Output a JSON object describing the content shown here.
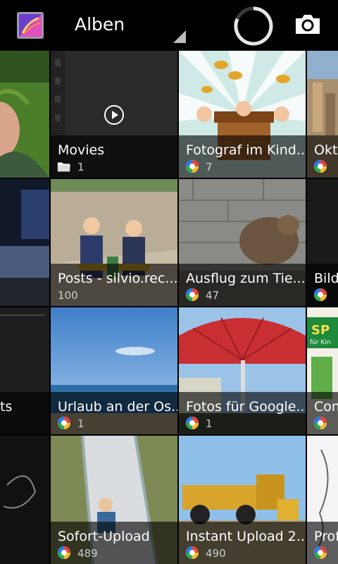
{
  "actionbar": {
    "title": "Alben"
  },
  "albums": [
    {
      "title": "",
      "count": ""
    },
    {
      "title": "Movies",
      "count": "1"
    },
    {
      "title": "Fotograf im Kind...",
      "count": "7"
    },
    {
      "title": "Okto",
      "count": ""
    },
    {
      "title": "",
      "count": ""
    },
    {
      "title": "Posts - silvio.rec...",
      "count": "100"
    },
    {
      "title": "Ausflug zum Tie...",
      "count": "47"
    },
    {
      "title": "Bild",
      "count": ""
    },
    {
      "title": "ts",
      "count": ""
    },
    {
      "title": "Urlaub an der Os...",
      "count": "1"
    },
    {
      "title": "Fotos für Google...",
      "count": "1"
    },
    {
      "title": "Con",
      "count": ""
    },
    {
      "title": "",
      "count": ""
    },
    {
      "title": "Sofort-Upload",
      "count": "489"
    },
    {
      "title": "Instant Upload 2...",
      "count": "490"
    },
    {
      "title": "Prof",
      "count": ""
    }
  ],
  "thumb_text": {
    "sp_sign": "SP",
    "sp_sub": "für Kin"
  },
  "icons": {
    "app": "gallery-app-icon",
    "dropdown": "dropdown-triangle-icon",
    "progress": "loading-spinner-icon",
    "camera": "camera-icon",
    "play": "play-icon",
    "folder": "folder-icon",
    "picasa": "picasa-icon"
  },
  "colors": {
    "background": "#000000",
    "label_overlay": "rgba(0,0,0,0.62)",
    "count_text": "#cfcfcf"
  }
}
